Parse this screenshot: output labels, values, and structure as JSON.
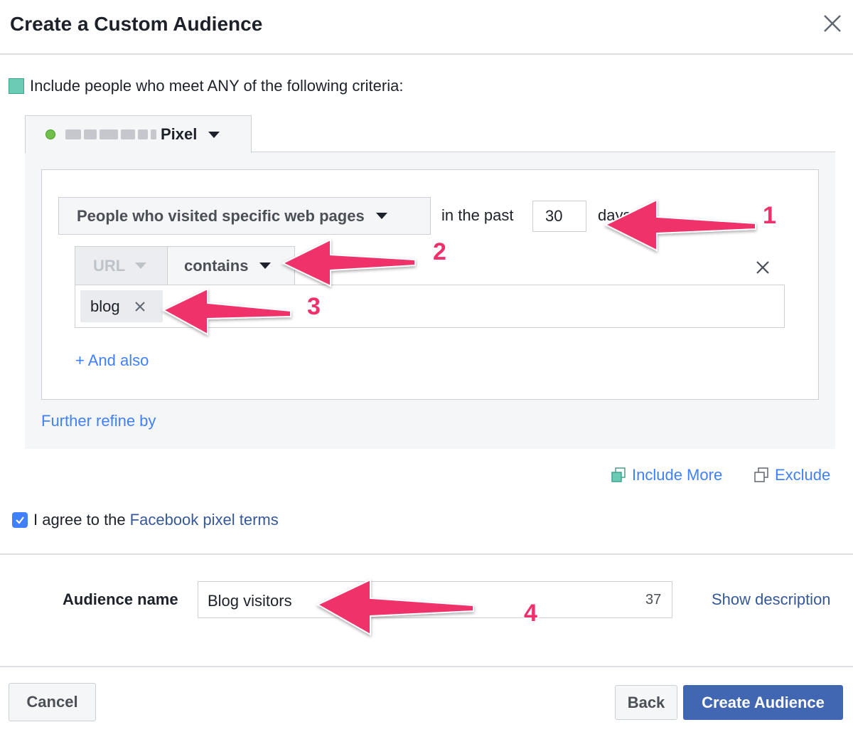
{
  "dialog": {
    "title": "Create a Custom Audience"
  },
  "criteria": {
    "label": "Include people who meet ANY of the following criteria:"
  },
  "pixel": {
    "name": "Pixel",
    "status_color": "#6fc049"
  },
  "rule": {
    "visited_option": "People who visited specific web pages",
    "in_the_past_label": "in the past",
    "days_value": "30",
    "days_label": "days",
    "url_field": "URL",
    "operator": "contains",
    "token": "blog",
    "and_also": "+ And also",
    "further_refine": "Further refine by"
  },
  "actions": {
    "include_more": "Include More",
    "exclude": "Exclude"
  },
  "terms": {
    "prefix": "I agree to the",
    "link": "Facebook pixel terms",
    "checked": true
  },
  "audience": {
    "label": "Audience name",
    "value": "Blog visitors",
    "remaining_chars": "37",
    "show_description": "Show description"
  },
  "footer": {
    "cancel": "Cancel",
    "back": "Back",
    "create": "Create Audience"
  },
  "annotations": {
    "numbers": [
      "1",
      "2",
      "3",
      "4"
    ],
    "color": "#f0306b"
  },
  "colors": {
    "link": "#4080ff",
    "primary_button": "#4267b2",
    "teal_square": "#6bcbb5"
  }
}
